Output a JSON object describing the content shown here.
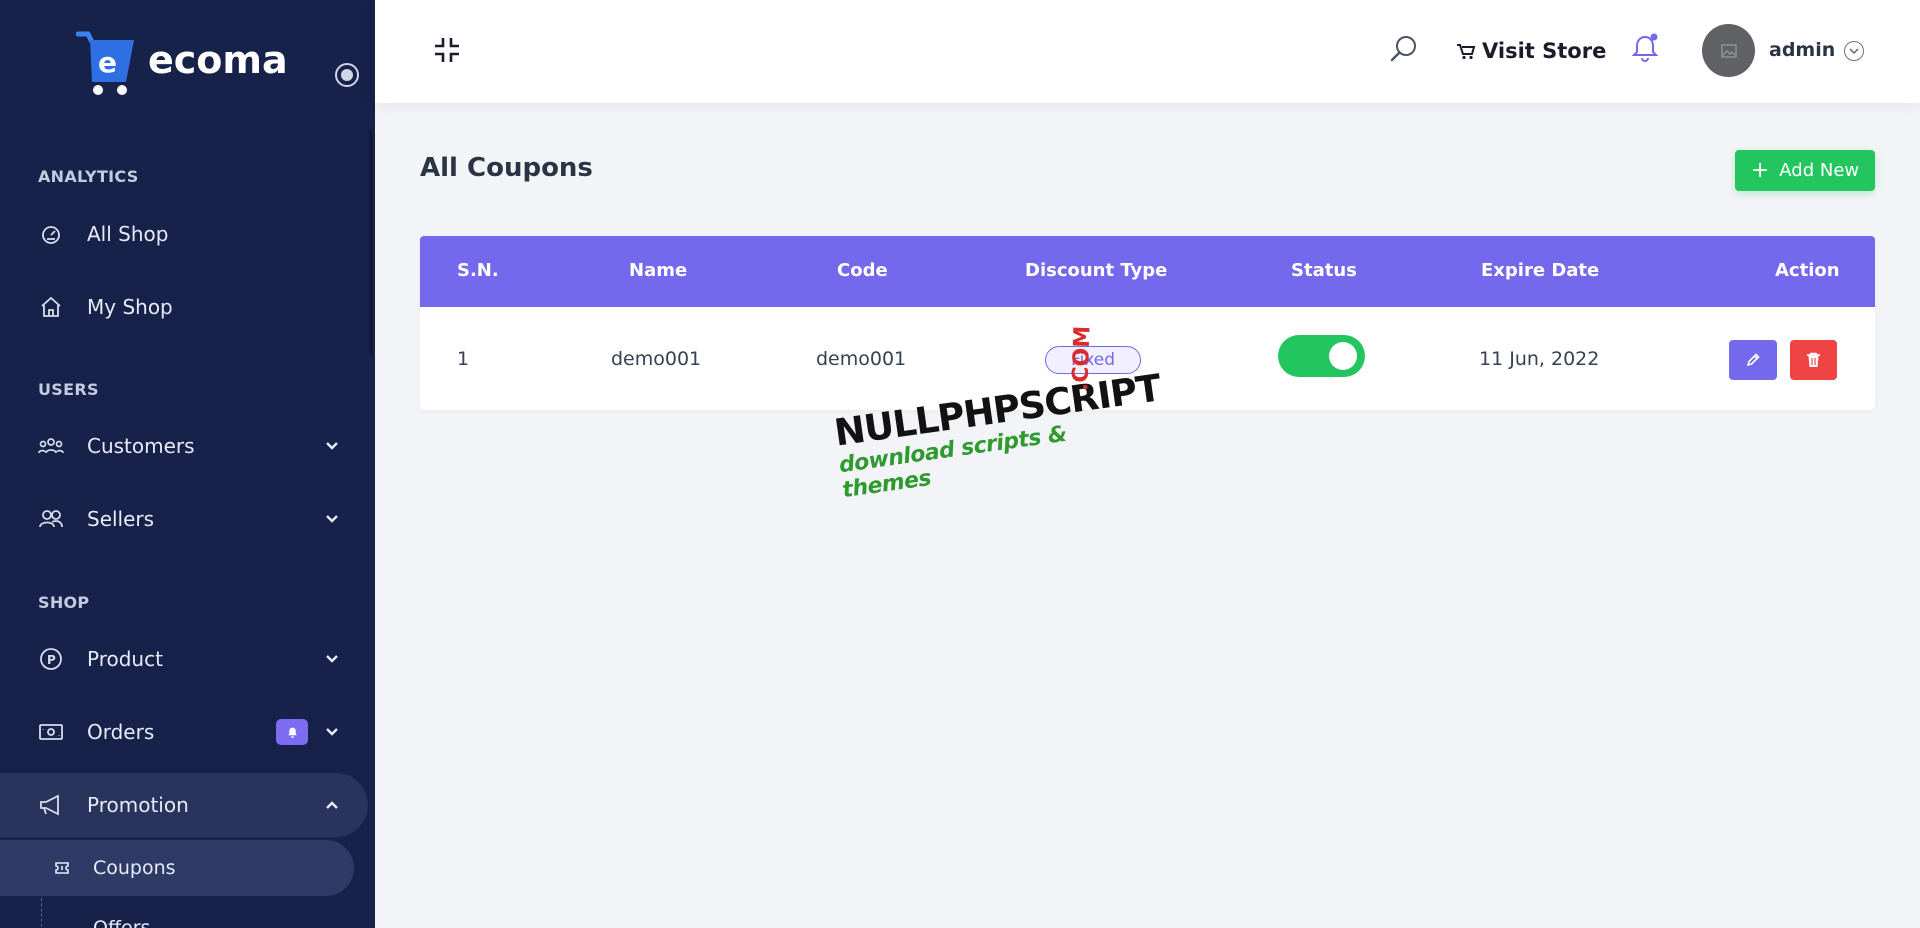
{
  "brand": {
    "logo_text": "ecoma"
  },
  "sidebar": {
    "sections": {
      "analytics": "ANALYTICS",
      "users": "USERS",
      "shop": "SHOP"
    },
    "items": {
      "all_shop": "All Shop",
      "my_shop": "My Shop",
      "customers": "Customers",
      "sellers": "Sellers",
      "product": "Product",
      "orders": "Orders",
      "promotion": "Promotion"
    },
    "subitems": {
      "coupons": "Coupons",
      "offers": "Offers"
    }
  },
  "header": {
    "visit_store": "Visit Store",
    "user_name": "admin"
  },
  "page": {
    "title": "All Coupons",
    "add_new": "Add New"
  },
  "table": {
    "columns": [
      "S.N.",
      "Name",
      "Code",
      "Discount Type",
      "Status",
      "Expire Date",
      "Action"
    ],
    "rows": [
      {
        "sn": "1",
        "name": "demo001",
        "code": "demo001",
        "discount_type": "Fixed",
        "status": "on",
        "expire_date": "11 Jun, 2022"
      }
    ]
  },
  "watermark": {
    "main": "NULLPHPSCRIPT",
    "com": ".COM",
    "sub": "download scripts & themes"
  },
  "colors": {
    "sidebar_bg": "#17224a",
    "accent": "#7468ec",
    "success": "#22c55e",
    "danger": "#ef4444"
  }
}
